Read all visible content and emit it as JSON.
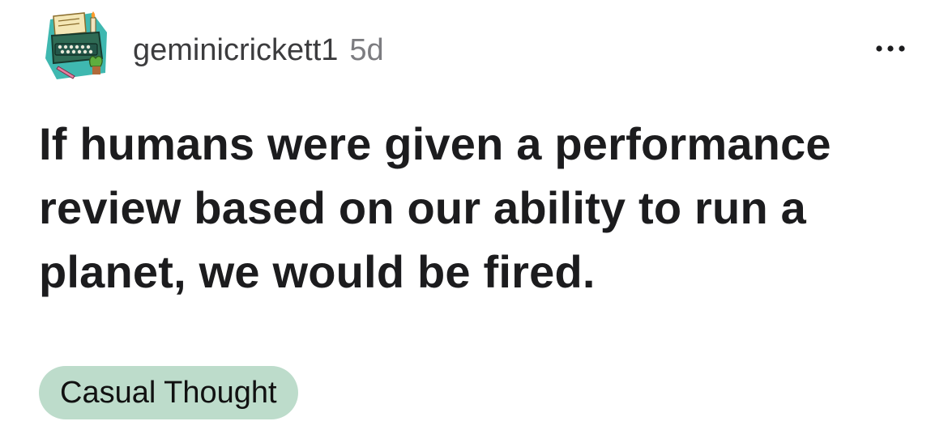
{
  "post": {
    "author": "geminicrickett1",
    "age": "5d",
    "title": "If humans were given a performance review based on our ability to run a planet, we would be fired.",
    "flair": "Casual Thought",
    "avatar_icon": "typewriter-avatar-icon",
    "more_icon": "more-options-icon"
  },
  "colors": {
    "flair_bg": "#bddccb",
    "title_text": "#1c1c1e",
    "meta_text": "#7c7c80"
  }
}
